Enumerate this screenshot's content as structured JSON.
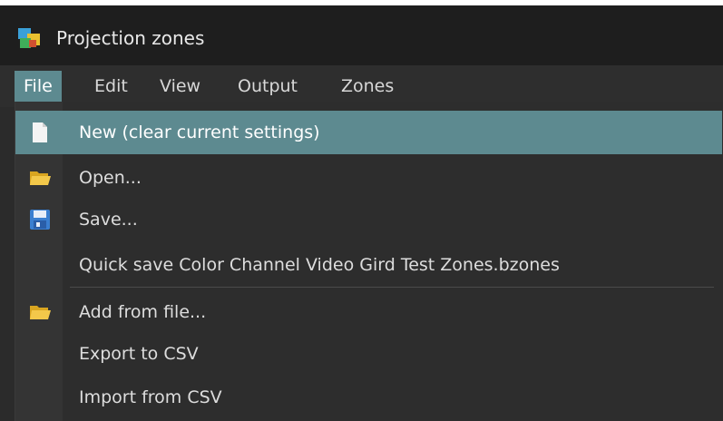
{
  "window": {
    "title": "Projection zones",
    "icon": "app-icon"
  },
  "menubar": {
    "items": [
      {
        "label": "File",
        "active": true
      },
      {
        "label": "Edit"
      },
      {
        "label": "View"
      },
      {
        "label": "Output"
      },
      {
        "label": "Zones"
      }
    ]
  },
  "file_menu": {
    "items": [
      {
        "label": "New (clear current settings)",
        "icon": "new-document-icon",
        "highlighted": true
      },
      {
        "label": "Open...",
        "icon": "folder-open-icon"
      },
      {
        "label": "Save...",
        "icon": "save-disk-icon"
      },
      {
        "label": "Quick save Color Channel Video Gird Test Zones.bzones",
        "icon": ""
      },
      {
        "label": "Add from file...",
        "icon": "folder-add-icon"
      },
      {
        "label": "Export to CSV",
        "icon": ""
      },
      {
        "label": "Import from CSV",
        "icon": ""
      }
    ]
  },
  "colors": {
    "accent": "#5d8a90",
    "background": "#2b2b2b",
    "titlebar": "#1e1e1e"
  }
}
